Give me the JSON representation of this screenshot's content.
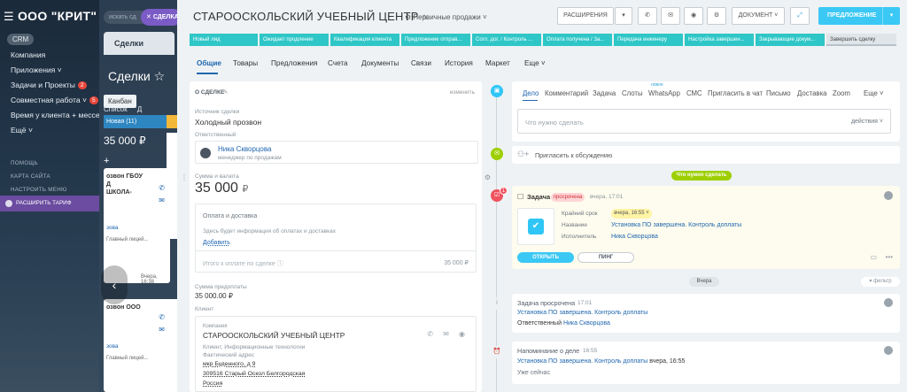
{
  "left_nav": {
    "logo": "ООО \"КРИТ\"",
    "crm_chip": "CRM",
    "items": [
      {
        "label": "Компания"
      },
      {
        "label": "Приложения ˅"
      },
      {
        "label": "Задачи и Проекты",
        "badge": "2"
      },
      {
        "label": "Совместная работа ˅",
        "badge": "5"
      },
      {
        "label": "Время у клиента + мессе..."
      },
      {
        "label": "Ещё ˅"
      }
    ],
    "help": "ПОМОЩЬ",
    "site_map": "КАРТА САЙТА",
    "menu_settings": "НАСТРОИТЬ МЕНЮ",
    "tariff": "РАСШИРИТЬ ТАРИФ"
  },
  "deals_bg": {
    "search_placeholder": "искать сд",
    "new_deal": "СДЕЛКА",
    "tab": "Сделки",
    "title": "Сделки ☆",
    "views": [
      "Канбан",
      "Список",
      "Д"
    ],
    "column": "Новая (11)",
    "amount": "35 000 ₽",
    "plus": "+",
    "card1": {
      "title": "озвон ГБОУ\nД\nШКОЛА-",
      "link": "зова",
      "contact": "Главный лицей...",
      "time": "Вчера, 16:38"
    },
    "card2": {
      "title": "озвон ООО",
      "link": "зова",
      "contact": "Главный лицей..."
    }
  },
  "header": {
    "title": "СТАРООСКОЛЬСКИЙ УЧЕБНЫЙ ЦЕНТР",
    "pipeline": "Первичные продажи ˅",
    "extensions": "РАСШИРЕНИЯ",
    "document": "ДОКУМЕНТ ˅",
    "offer": "ПРЕДЛОЖЕНИЕ"
  },
  "stages": [
    "Новый лид",
    "Ожидает продление",
    "Квалификация клиента",
    "Предложение отправ...",
    "Согл. дог. / Контроль ...",
    "Оплата получена / За...",
    "Передача инженеру",
    "Настройка завершен...",
    "Закрывающие докум...",
    "Завершить сделку"
  ],
  "tabs": [
    "Общие",
    "Товары",
    "Предложения",
    "Счета",
    "Документы",
    "Связи",
    "История",
    "Маркет",
    "Еще ˅"
  ],
  "about": {
    "section": "О СДЕЛКЕ",
    "edit": "изменить",
    "source_label": "Источник сделки",
    "source_value": "Холодный прозвон",
    "responsible_label": "Ответственный",
    "responsible_name": "Ника Скворцова",
    "responsible_role": "менеджер по продажам",
    "amount_label": "Сумма и валюта",
    "amount_value": "35 000",
    "currency": "₽",
    "payment_title": "Оплата и доставка",
    "payment_info": "Здесь будет информация об оплатах и доставках",
    "payment_add": "Добавить",
    "total_label": "Итого к оплате по сделке",
    "total_value": "35 000 ₽",
    "prepay_label": "Сумма предоплаты",
    "prepay_value": "35 000.00 ₽",
    "client_label": "Клиент",
    "company_label": "Компания",
    "company_name": "СТАРООСКОЛЬСКИЙ УЧЕБНЫЙ ЦЕНТР",
    "company_type": "Клиент, Информационные технологии",
    "address_label": "Фактический адрес",
    "address_line1": "мкр Буденного, д 9",
    "address_line2": "309516 Старый Оскол Белгородская",
    "address_line3": "Россия"
  },
  "timeline": {
    "tabs": [
      "Дело",
      "Комментарий",
      "Задача",
      "Слоты",
      "WhatsApp",
      "СМС",
      "Пригласить в чат",
      "Письмо",
      "Доставка",
      "Zoom",
      "Еще ˅"
    ],
    "new_badge": "новое",
    "todo_placeholder": "Что нужно сделать",
    "actions": "действия ˅",
    "invite": "Пригласить к обсуждению",
    "todo_pill": "Что нужно сделать",
    "task": {
      "title": "Задача",
      "status": "просрочена",
      "time": "вчера, 17:01",
      "deadline_label": "Крайний срок",
      "deadline_value": "вчера, 16:55 ˅",
      "name_label": "Название",
      "name_value": "Установка ПО завершена. Контроль доплаты",
      "exec_label": "Исполнитель",
      "exec_value": "Ника Скворцова",
      "open": "ОТКРЫТЬ",
      "ping": "ПИНГ",
      "counter": "1"
    },
    "yesterday": "Вчера",
    "filter": "▾ фильтр",
    "overdue": {
      "title": "Задача просрочена",
      "time": "17:01",
      "link": "Установка ПО завершена. Контроль доплаты",
      "resp_label": "Ответственный",
      "resp_name": "Ника Скворцова"
    },
    "reminder": {
      "title": "Напоминание о деле",
      "time": "16:55",
      "link": "Установка ПО завершена. Контроль доплаты",
      "when": "вчера, 16:55",
      "now": "Уже сейчас"
    }
  },
  "colors": {
    "stage": "#2fc6c7",
    "accent": "#2067b0",
    "primary": "#3bc8f5",
    "green": "#9dcf00",
    "overdue": "#f0525e"
  }
}
